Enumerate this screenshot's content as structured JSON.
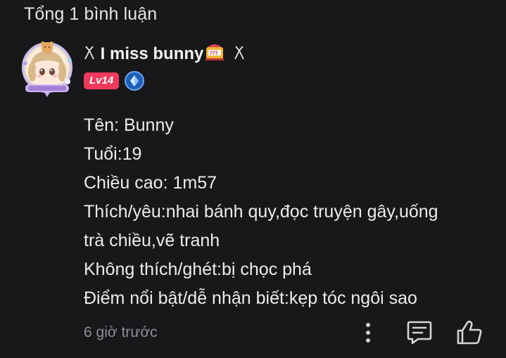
{
  "header": {
    "total_comments": "Tổng 1 bình luận"
  },
  "comment": {
    "username": "I miss bunny",
    "username_prefix_icon": "tongs-icon",
    "username_suffix_icon": "slot-machine-icon",
    "username_trailing_icon": "tongs-icon",
    "level_badge": "Lv14",
    "verified_icon": "blue-crystal-icon",
    "lines": [
      "Tên: Bunny",
      "Tuổi:19",
      "Chiều cao: 1m57",
      "Thích/yêu:nhai bánh quy,đọc truyện gây,uống",
      "trà chiều,vẽ tranh",
      "Không thích/ghét:bị chọc phá",
      "Điểm nổi bật/dễ nhận biết:kẹp tóc ngôi sao"
    ],
    "time_ago": "6 giờ trước"
  },
  "colors": {
    "background": "#18181b",
    "level_badge": "#ef3a5d",
    "verified": "#1e5eb8",
    "meta_text": "#8e8e93"
  }
}
